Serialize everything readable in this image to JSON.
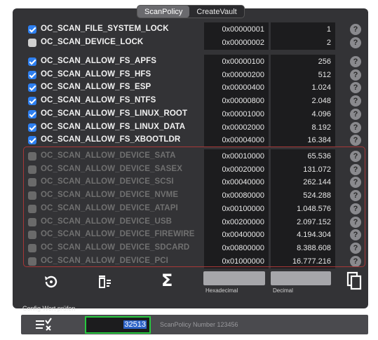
{
  "tabs": [
    "ScanPolicy",
    "CreateVault"
  ],
  "general_flags": [
    {
      "label": "OC_SCAN_FILE_SYSTEM_LOCK",
      "hex": "0x00000001",
      "dec": "1",
      "checked": true
    },
    {
      "label": "OC_SCAN_DEVICE_LOCK",
      "hex": "0x00000002",
      "dec": "2",
      "checked": false
    }
  ],
  "fs_flags": [
    {
      "label": "OC_SCAN_ALLOW_FS_APFS",
      "hex": "0x00000100",
      "dec": "256",
      "checked": true
    },
    {
      "label": "OC_SCAN_ALLOW_FS_HFS",
      "hex": "0x00000200",
      "dec": "512",
      "checked": true
    },
    {
      "label": "OC_SCAN_ALLOW_FS_ESP",
      "hex": "0x00000400",
      "dec": "1.024",
      "checked": true
    },
    {
      "label": "OC_SCAN_ALLOW_FS_NTFS",
      "hex": "0x00000800",
      "dec": "2.048",
      "checked": true
    },
    {
      "label": "OC_SCAN_ALLOW_FS_LINUX_ROOT",
      "hex": "0x00001000",
      "dec": "4.096",
      "checked": true
    },
    {
      "label": "OC_SCAN_ALLOW_FS_LINUX_DATA",
      "hex": "0x00002000",
      "dec": "8.192",
      "checked": true
    },
    {
      "label": "OC_SCAN_ALLOW_FS_XBOOTLDR",
      "hex": "0x00004000",
      "dec": "16.384",
      "checked": true
    }
  ],
  "device_flags": [
    {
      "label": "OC_SCAN_ALLOW_DEVICE_SATA",
      "hex": "0x00010000",
      "dec": "65.536",
      "checked": false
    },
    {
      "label": "OC_SCAN_ALLOW_DEVICE_SASEX",
      "hex": "0x00020000",
      "dec": "131.072",
      "checked": false
    },
    {
      "label": "OC_SCAN_ALLOW_DEVICE_SCSI",
      "hex": "0x00040000",
      "dec": "262.144",
      "checked": false
    },
    {
      "label": "OC_SCAN_ALLOW_DEVICE_NVME",
      "hex": "0x00080000",
      "dec": "524.288",
      "checked": false
    },
    {
      "label": "OC_SCAN_ALLOW_DEVICE_ATAPI",
      "hex": "0x00100000",
      "dec": "1.048.576",
      "checked": false
    },
    {
      "label": "OC_SCAN_ALLOW_DEVICE_USB",
      "hex": "0x00200000",
      "dec": "2.097.152",
      "checked": false
    },
    {
      "label": "OC_SCAN_ALLOW_DEVICE_FIREWIRE",
      "hex": "0x00400000",
      "dec": "4.194.304",
      "checked": false
    },
    {
      "label": "OC_SCAN_ALLOW_DEVICE_SDCARD",
      "hex": "0x00800000",
      "dec": "8.388.608",
      "checked": false
    },
    {
      "label": "OC_SCAN_ALLOW_DEVICE_PCI",
      "hex": "0x01000000",
      "dec": "16.777.216",
      "checked": false
    }
  ],
  "help_glyph": "?",
  "toolbar": {
    "hex_label": "Hexadecimal",
    "dec_label": "Decimal",
    "sum_glyph": "Σ"
  },
  "config": {
    "label": "Config Wert prüfen",
    "value": "32513",
    "number_label": "ScanPolicy Number 123456"
  },
  "colors": {
    "checkbox_on": "#2d7ff0",
    "device_border": "#a83838",
    "input_border": "#27c93f"
  }
}
